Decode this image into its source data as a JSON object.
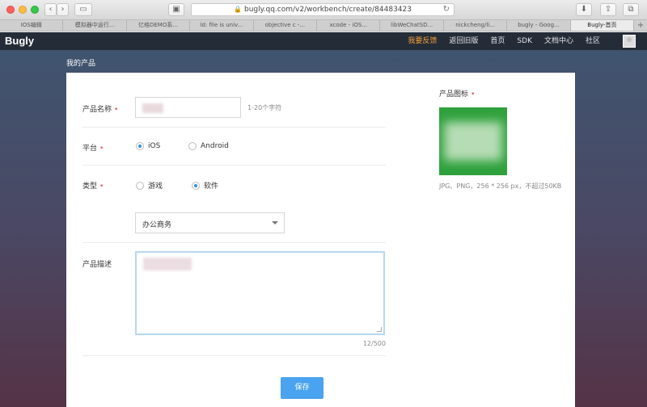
{
  "browser": {
    "url": "bugly.qq.com/v2/workbench/create/84483423",
    "tabs": [
      {
        "label": "IOS编辑",
        "active": false
      },
      {
        "label": "模拟器中运行...",
        "active": false
      },
      {
        "label": "亿格DEMO系...",
        "active": false
      },
      {
        "label": "ld: file is univ...",
        "active": false
      },
      {
        "label": "objective c -...",
        "active": false
      },
      {
        "label": "xcode - iOS...",
        "active": false
      },
      {
        "label": "libWeChatSD...",
        "active": false
      },
      {
        "label": "nickcheng/li...",
        "active": false
      },
      {
        "label": "bugly - Goog...",
        "active": false
      },
      {
        "label": "Bugly-首页",
        "active": true
      }
    ]
  },
  "header": {
    "logo": "Bugly",
    "nav": [
      {
        "label": "我要反馈",
        "highlight": true
      },
      {
        "label": "返回旧版",
        "highlight": false
      },
      {
        "label": "首页",
        "highlight": false
      },
      {
        "label": "SDK",
        "highlight": false
      },
      {
        "label": "文档中心",
        "highlight": false
      },
      {
        "label": "社区",
        "highlight": false
      }
    ]
  },
  "breadcrumb": "我的产品",
  "form": {
    "name_label": "产品名称",
    "name_value": "",
    "name_hint": "1-20个字符",
    "platform_label": "平台",
    "platform_options": [
      "iOS",
      "Android"
    ],
    "platform_selected": "iOS",
    "type_label": "类型",
    "type_options": [
      "游戏",
      "软件"
    ],
    "type_selected": "软件",
    "category_value": "办公商务",
    "desc_label": "产品描述",
    "desc_counter": "12/500",
    "required_mark": "•",
    "save_label": "保存"
  },
  "icon_panel": {
    "label": "产品图标",
    "hint": "JPG、PNG，256 * 256 px，不超过50KB",
    "color": "#2fa13c"
  }
}
